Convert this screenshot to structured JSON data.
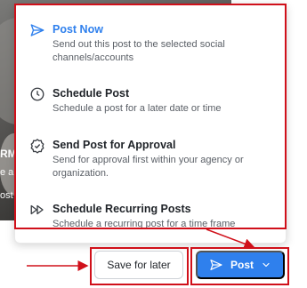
{
  "background": {
    "text1": "RM",
    "text2": "e a",
    "text3": "ost"
  },
  "menu": {
    "items": [
      {
        "icon": "send-icon",
        "title": "Post Now",
        "desc": "Send out this post to the selected social channels/accounts",
        "active": true
      },
      {
        "icon": "clock-icon",
        "title": "Schedule Post",
        "desc": "Schedule a post for a later date or time",
        "active": false
      },
      {
        "icon": "badge-check-icon",
        "title": "Send Post for Approval",
        "desc": "Send for approval first within your agency or organization.",
        "active": false
      },
      {
        "icon": "double-play-icon",
        "title": "Schedule Recurring Posts",
        "desc": "Schedule a recurring post for a time frame",
        "active": false
      }
    ]
  },
  "buttons": {
    "save_label": "Save for later",
    "post_label": "Post"
  },
  "colors": {
    "accent": "#2f80ed",
    "annotation": "#d0101a"
  }
}
